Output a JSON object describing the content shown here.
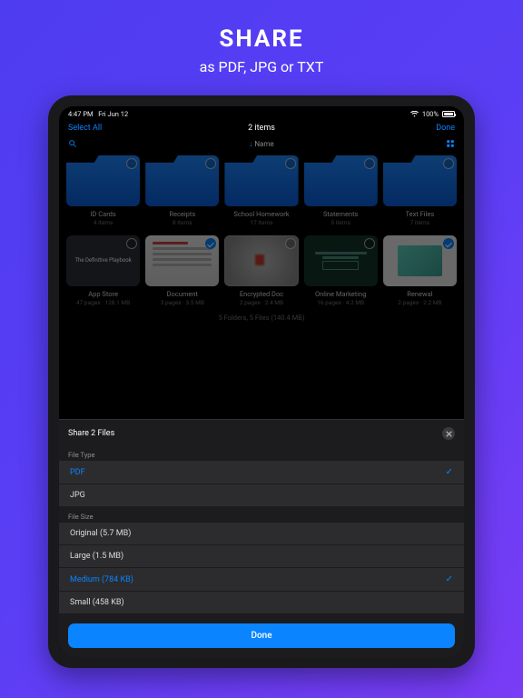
{
  "promo": {
    "title": "SHARE",
    "subtitle": "as PDF, JPG or TXT"
  },
  "status": {
    "time": "4:47 PM",
    "date": "Fri Jun 12",
    "battery": "100%"
  },
  "nav": {
    "left": "Select All",
    "title": "2 items",
    "right": "Done"
  },
  "sort": {
    "prefix": "↓",
    "label": "Name"
  },
  "folders": [
    {
      "name": "ID Cards",
      "sub": "4 items"
    },
    {
      "name": "Receipts",
      "sub": "8 items"
    },
    {
      "name": "School Homework",
      "sub": "17 items"
    },
    {
      "name": "Statements",
      "sub": "5 items"
    },
    {
      "name": "Text Files",
      "sub": "7 items"
    }
  ],
  "files": [
    {
      "name": "App Store",
      "sub": "47 pages · 128.1 MB",
      "kind": "playbook",
      "selected": false,
      "thumb_text": "The Definitive Playbook"
    },
    {
      "name": "Document",
      "sub": "3 pages · 3.5 MB",
      "kind": "doc",
      "selected": true
    },
    {
      "name": "Encrypted Doc",
      "sub": "2 pages · 2.4 MB",
      "kind": "enc",
      "selected": false
    },
    {
      "name": "Online Marketing",
      "sub": "16 pages · 4.2 MB",
      "kind": "om",
      "selected": false
    },
    {
      "name": "Renewal",
      "sub": "2 pages · 2.2 MB",
      "kind": "renewal",
      "selected": true
    }
  ],
  "summary": "5 Folders, 5 Files (140.4 MB)",
  "sheet": {
    "title": "Share 2 Files",
    "section_type": "File Type",
    "types": [
      {
        "label": "PDF",
        "selected": true
      },
      {
        "label": "JPG",
        "selected": false
      }
    ],
    "section_size": "File Size",
    "sizes": [
      {
        "label": "Original (5.7 MB)",
        "selected": false
      },
      {
        "label": "Large (1.5 MB)",
        "selected": false
      },
      {
        "label": "Medium (784 KB)",
        "selected": true
      },
      {
        "label": "Small (458 KB)",
        "selected": false
      }
    ],
    "done": "Done"
  }
}
